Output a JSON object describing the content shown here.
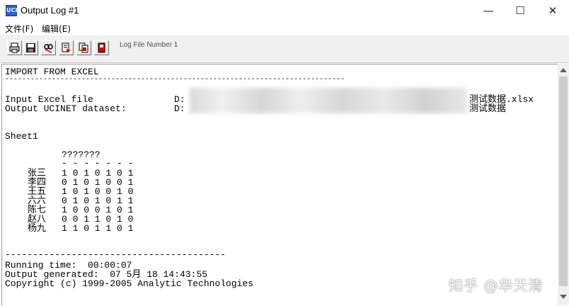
{
  "window": {
    "title": "Output Log #1",
    "icon": "ucinet-app-icon",
    "controls": {
      "minimize": "—",
      "maximize": "☐",
      "close": "✕"
    }
  },
  "menu": [
    "文件(F)",
    "编辑(E)"
  ],
  "toolbar": {
    "buttons": [
      "print-icon",
      "save-icon",
      "find-icon",
      "export-icon",
      "copy-icon",
      "stop-icon"
    ],
    "label": "Log File Number 1"
  },
  "log": {
    "title": "IMPORT FROM EXCEL",
    "separator": "--------------------------------------------------------------------------------",
    "input_label": "Input Excel file",
    "input_drive": "D:",
    "input_suffix": "测试数据.xlsx",
    "output_label": "Output UCINET dataset:",
    "output_drive": "D:",
    "output_suffix": "测试数据",
    "sheet": "Sheet1",
    "matrix_header": "???????",
    "matrix_dashes": "- - - - - - -",
    "rows": [
      {
        "name": "张三",
        "values": "1 0 1 0 1 0 1"
      },
      {
        "name": "李四",
        "values": "0 1 0 1 0 0 1"
      },
      {
        "name": "王五",
        "values": "1 0 1 0 0 1 0"
      },
      {
        "name": "六六",
        "values": "0 1 0 1 0 1 1"
      },
      {
        "name": "陈七",
        "values": "1 0 0 0 1 0 1"
      },
      {
        "name": "赵八",
        "values": "0 0 1 1 0 1 0"
      },
      {
        "name": "杨九",
        "values": "1 1 0 1 1 0 1"
      }
    ],
    "footer_separator": "----------------------------------------",
    "running_time": "Running time:  00:00:07",
    "output_generated": "Output generated:  07 5月 18 14:43:55",
    "copyright": "Copyright (c) 1999-2005 Analytic Technologies"
  },
  "watermark": "知乎 @华天清"
}
